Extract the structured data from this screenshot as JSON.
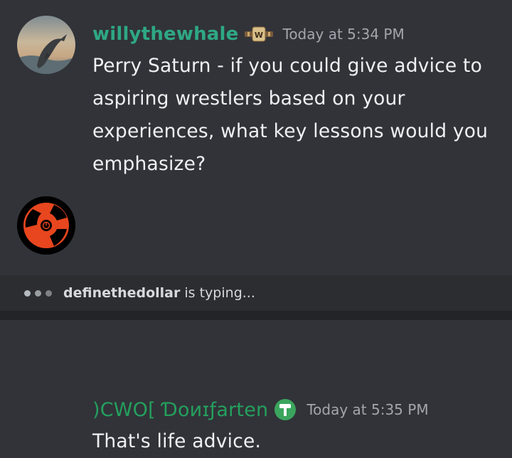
{
  "messages": [
    {
      "username": "willythewhale",
      "timestamp": "Today at 5:34 PM",
      "badge_icon": "wwe-title-belt-icon",
      "text": "Perry Saturn - if you could give advice to aspiring wrestlers based on your experiences, what key lessons would you emphasize?",
      "username_color": "#2ea884"
    },
    {
      "username": ")CWO[ Ɗoиɪƒarten",
      "timestamp": "Today at 5:35 PM",
      "badge_icon": "hammer-icon",
      "text": "That's life advice.",
      "username_color": "#24a05e"
    }
  ],
  "typing": {
    "user": "definethedollar",
    "suffix": " is typing..."
  },
  "colors": {
    "background": "#313338",
    "typing_bar": "#2b2d31",
    "avatar_accent": "#e8461e"
  }
}
